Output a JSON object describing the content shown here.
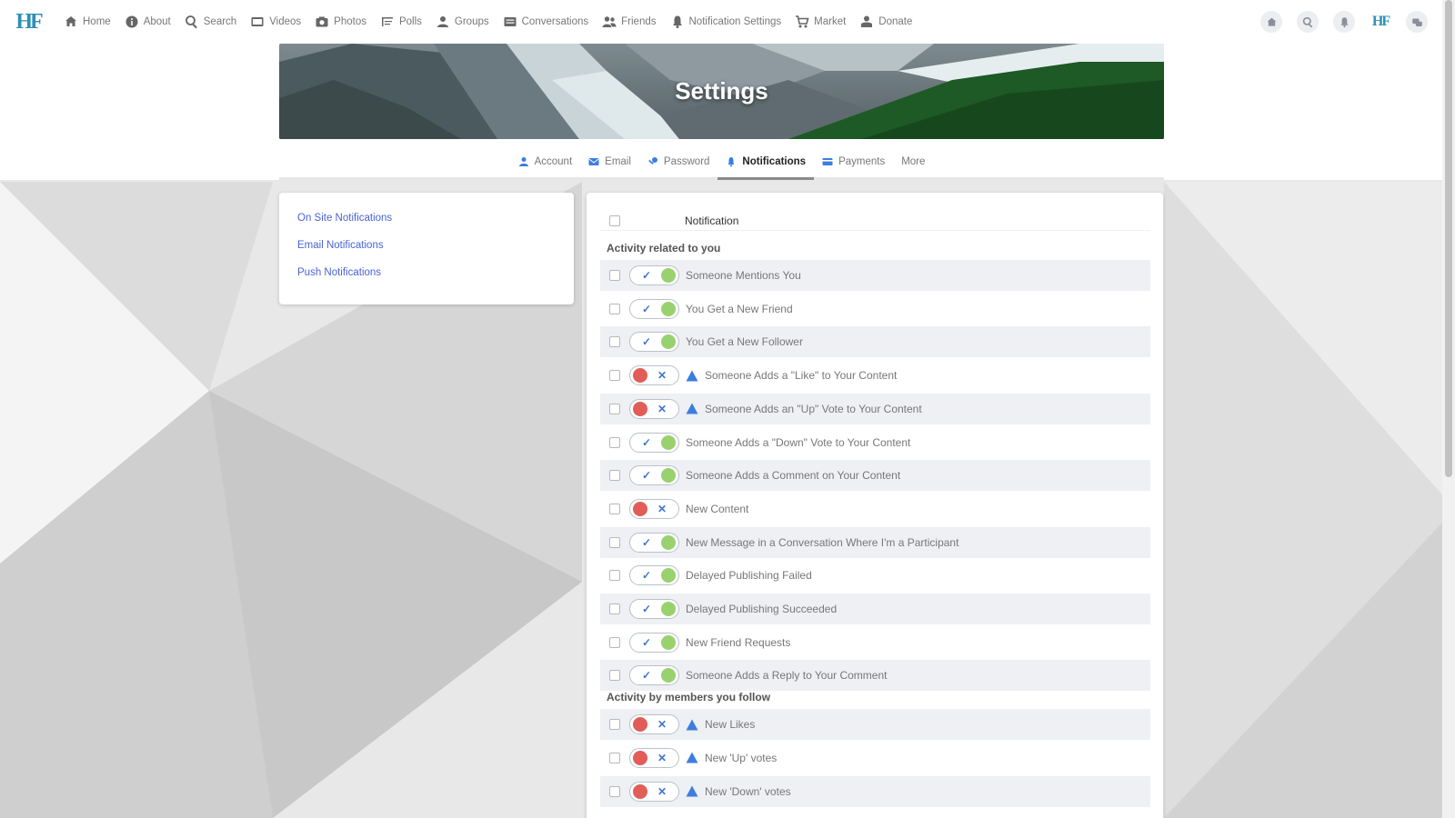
{
  "app": {
    "logo": "HF"
  },
  "nav": [
    {
      "label": "Home",
      "icon": "home-icon"
    },
    {
      "label": "About",
      "icon": "info-icon"
    },
    {
      "label": "Search",
      "icon": "search-icon"
    },
    {
      "label": "Videos",
      "icon": "video-icon"
    },
    {
      "label": "Photos",
      "icon": "camera-icon"
    },
    {
      "label": "Polls",
      "icon": "poll-icon"
    },
    {
      "label": "Groups",
      "icon": "group-icon"
    },
    {
      "label": "Conversations",
      "icon": "chat-icon"
    },
    {
      "label": "Friends",
      "icon": "friends-icon"
    },
    {
      "label": "Notification Settings",
      "icon": "bell-icon"
    },
    {
      "label": "Market",
      "icon": "cart-icon"
    },
    {
      "label": "Donate",
      "icon": "donate-icon"
    }
  ],
  "top_right": {
    "logo": "HF"
  },
  "banner": {
    "title": "Settings"
  },
  "tabs": [
    {
      "label": "Account",
      "icon": "user-icon",
      "active": false
    },
    {
      "label": "Email",
      "icon": "mail-icon",
      "active": false
    },
    {
      "label": "Password",
      "icon": "key-icon",
      "active": false
    },
    {
      "label": "Notifications",
      "icon": "bell-icon",
      "active": true
    },
    {
      "label": "Payments",
      "icon": "card-icon",
      "active": false
    },
    {
      "label": "More",
      "icon": "",
      "active": false
    }
  ],
  "sidebar": {
    "links": [
      "On Site Notifications",
      "Email Notifications",
      "Push Notifications"
    ]
  },
  "table": {
    "header": "Notification",
    "sections": [
      {
        "title": "Activity related to you",
        "rows": [
          {
            "label": "Someone Mentions You",
            "on": true,
            "warn": false
          },
          {
            "label": "You Get a New Friend",
            "on": true,
            "warn": false
          },
          {
            "label": "You Get a New Follower",
            "on": true,
            "warn": false
          },
          {
            "label": "Someone Adds a \"Like\" to Your Content",
            "on": false,
            "warn": true
          },
          {
            "label": "Someone Adds an \"Up\" Vote to Your Content",
            "on": false,
            "warn": true
          },
          {
            "label": "Someone Adds a \"Down\" Vote to Your Content",
            "on": true,
            "warn": false
          },
          {
            "label": "Someone Adds a Comment on Your Content",
            "on": true,
            "warn": false
          },
          {
            "label": "New Content",
            "on": false,
            "warn": false
          },
          {
            "label": "New Message in a Conversation Where I'm a Participant",
            "on": true,
            "warn": false
          },
          {
            "label": "Delayed Publishing Failed",
            "on": true,
            "warn": false
          },
          {
            "label": "Delayed Publishing Succeeded",
            "on": true,
            "warn": false
          },
          {
            "label": "New Friend Requests",
            "on": true,
            "warn": false
          },
          {
            "label": "Someone Adds a Reply to Your Comment",
            "on": true,
            "warn": false
          }
        ]
      },
      {
        "title": "Activity by members you follow",
        "rows": [
          {
            "label": "New Likes",
            "on": false,
            "warn": true
          },
          {
            "label": "New 'Up' votes",
            "on": false,
            "warn": true
          },
          {
            "label": "New 'Down' votes",
            "on": false,
            "warn": true
          }
        ]
      }
    ]
  },
  "colors": {
    "accent_blue": "#4a63d8",
    "toggle_on": "#9ad16f",
    "toggle_off": "#e25d57",
    "logo": "#2e8fb6"
  }
}
